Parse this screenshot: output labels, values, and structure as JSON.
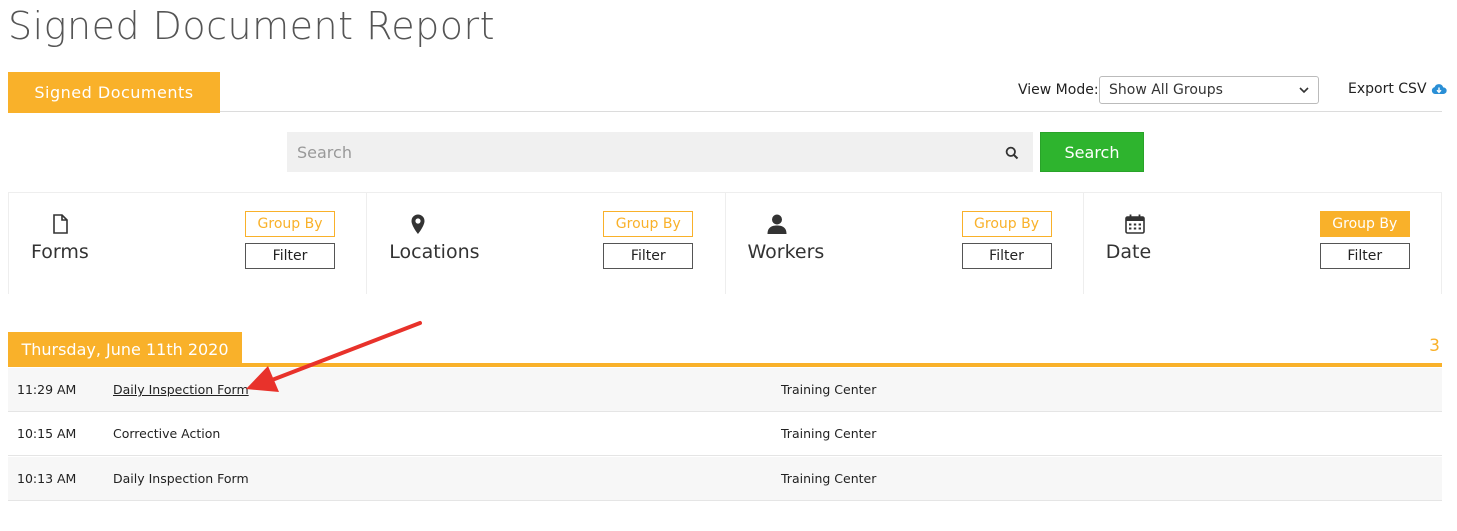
{
  "page": {
    "title": "Signed Document Report"
  },
  "tabs": {
    "active_label": "Signed Documents"
  },
  "toolbar": {
    "view_mode_label": "View Mode:",
    "view_mode_value": "Show All Groups",
    "export_label": "Export CSV"
  },
  "search": {
    "placeholder": "Search",
    "button_label": "Search"
  },
  "filters": [
    {
      "label": "Forms",
      "icon": "document-icon",
      "group_by": "Group By",
      "filter": "Filter"
    },
    {
      "label": "Locations",
      "icon": "map-pin-icon",
      "group_by": "Group By",
      "filter": "Filter"
    },
    {
      "label": "Workers",
      "icon": "user-icon",
      "group_by": "Group By",
      "filter": "Filter"
    },
    {
      "label": "Date",
      "icon": "calendar-icon",
      "group_by": "Group By",
      "filter": "Filter",
      "active": true
    }
  ],
  "group": {
    "title": "Thursday, June 11th 2020",
    "count": "3",
    "rows": [
      {
        "time": "11:29 AM",
        "form": "Daily Inspection Form",
        "location": "Training Center"
      },
      {
        "time": "10:15 AM",
        "form": "Corrective Action",
        "location": "Training Center"
      },
      {
        "time": "10:13 AM",
        "form": "Daily Inspection Form",
        "location": "Training Center"
      }
    ]
  },
  "colors": {
    "accent": "#f9b12a",
    "search_button": "#2eb42e",
    "arrow": "#e8322b",
    "export_icon": "#2a8fd6"
  }
}
